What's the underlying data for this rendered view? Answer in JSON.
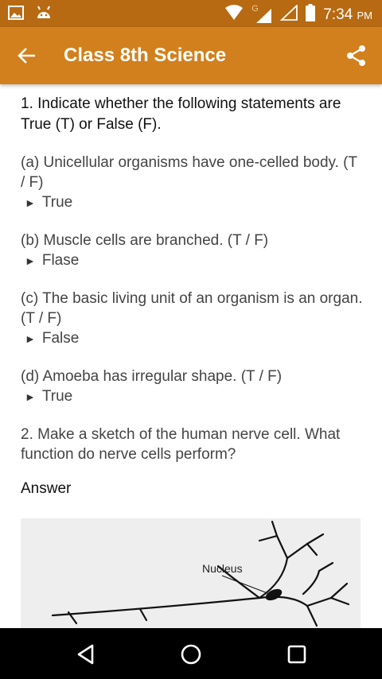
{
  "status_bar": {
    "time": "7:34",
    "ampm": "PM",
    "network_label": "G",
    "icons": [
      "gallery-icon",
      "android-icon",
      "wifi-icon",
      "signal-icon",
      "signal-icon",
      "battery-icon"
    ]
  },
  "app_bar": {
    "title": "Class 8th Science",
    "back_icon": "arrow-left-icon",
    "share_icon": "share-icon"
  },
  "content": {
    "q1": "1. Indicate whether the following statements are True (T) or False (F).",
    "items": [
      {
        "statement": "(a) Unicellular organisms have one-celled body. (T / F)",
        "answer": "True"
      },
      {
        "statement": "(b) Muscle cells are branched. (T / F)",
        "answer": "Flase"
      },
      {
        "statement": "(c) The basic living unit of an organism is an organ. (T / F)",
        "answer": "False"
      },
      {
        "statement": "(d) Amoeba has irregular shape. (T / F)",
        "answer": "True"
      }
    ],
    "answer_marker": "►",
    "q2": "2. Make a sketch of the human nerve cell. What function do nerve cells perform?",
    "answer_heading": "Answer",
    "sketch_label": "Nucleus"
  },
  "colors": {
    "status_bar": "#b76a12",
    "app_bar": "#d2801d",
    "nav_bar": "#000000"
  },
  "nav_bar": {
    "icons": [
      "back-triangle-icon",
      "home-circle-icon",
      "recents-square-icon"
    ]
  }
}
